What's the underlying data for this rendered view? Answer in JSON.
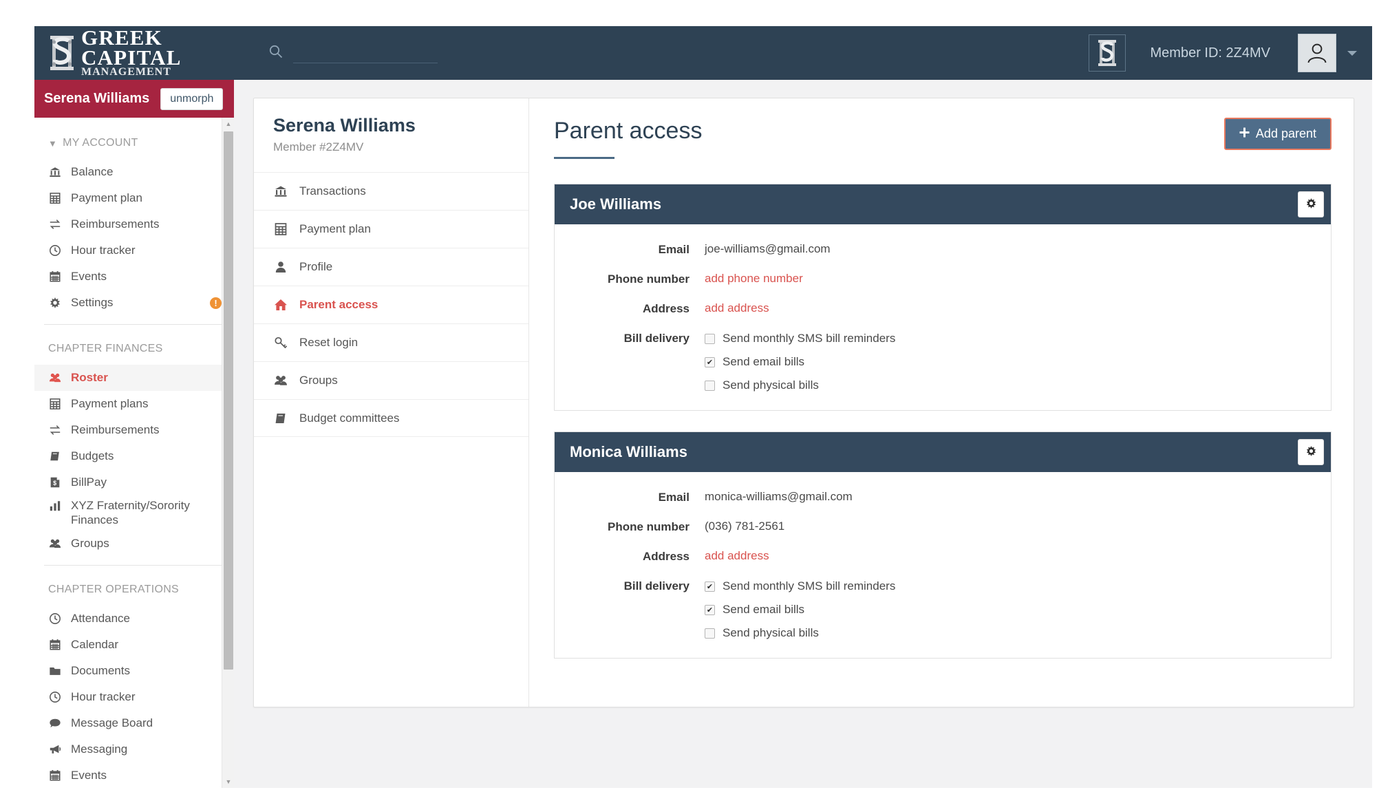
{
  "navbar": {
    "brand": {
      "line1": "GREEK",
      "line2": "CAPITAL",
      "line3": "MANAGEMENT",
      "logo_icon": "greek-column-s-logo"
    },
    "search": {
      "placeholder": "",
      "value": "",
      "icon": "search-icon"
    },
    "chapter_badge_icon": "chapter-crest-icon",
    "member_id": "Member ID: 2Z4MV",
    "avatar_icon": "user-avatar-icon",
    "caret_icon": "chevron-down-icon"
  },
  "morph": {
    "name": "Serena Williams",
    "unmorph_label": "unmorph"
  },
  "sidebar": {
    "groups": [
      {
        "title": "MY ACCOUNT",
        "collapsible": true,
        "items": [
          {
            "label": "Balance",
            "icon": "bank-icon",
            "active": false
          },
          {
            "label": "Payment plan",
            "icon": "calculator-icon",
            "active": false
          },
          {
            "label": "Reimbursements",
            "icon": "exchange-icon",
            "active": false
          },
          {
            "label": "Hour tracker",
            "icon": "clock-icon",
            "active": false
          },
          {
            "label": "Events",
            "icon": "calendar-icon",
            "active": false
          },
          {
            "label": "Settings",
            "icon": "gear-icon",
            "active": false,
            "badge": "!"
          }
        ]
      },
      {
        "title": "CHAPTER FINANCES",
        "collapsible": false,
        "items": [
          {
            "label": "Roster",
            "icon": "users-icon",
            "active": true
          },
          {
            "label": "Payment plans",
            "icon": "calculator-icon",
            "active": false
          },
          {
            "label": "Reimbursements",
            "icon": "exchange-icon",
            "active": false
          },
          {
            "label": "Budgets",
            "icon": "book-icon",
            "active": false
          },
          {
            "label": "BillPay",
            "icon": "invoice-dollar-icon",
            "active": false
          },
          {
            "label": "XYZ Fraternity/Sorority Finances",
            "icon": "bar-chart-icon",
            "active": false,
            "wrap": true
          },
          {
            "label": "Groups",
            "icon": "users-icon",
            "active": false
          }
        ]
      },
      {
        "title": "CHAPTER OPERATIONS",
        "collapsible": false,
        "items": [
          {
            "label": "Attendance",
            "icon": "clock-icon",
            "active": false
          },
          {
            "label": "Calendar",
            "icon": "calendar-icon",
            "active": false
          },
          {
            "label": "Documents",
            "icon": "folder-icon",
            "active": false
          },
          {
            "label": "Hour tracker",
            "icon": "clock-icon",
            "active": false
          },
          {
            "label": "Message Board",
            "icon": "comment-icon",
            "active": false
          },
          {
            "label": "Messaging",
            "icon": "bullhorn-icon",
            "active": false
          },
          {
            "label": "Events",
            "icon": "calendar-icon",
            "active": false
          }
        ]
      }
    ]
  },
  "member_nav": {
    "name": "Serena Williams",
    "subtitle": "Member #2Z4MV",
    "items": [
      {
        "label": "Transactions",
        "icon": "bank-icon",
        "active": false
      },
      {
        "label": "Payment plan",
        "icon": "calculator-icon",
        "active": false
      },
      {
        "label": "Profile",
        "icon": "user-icon",
        "active": false
      },
      {
        "label": "Parent access",
        "icon": "home-icon",
        "active": true
      },
      {
        "label": "Reset login",
        "icon": "key-icon",
        "active": false
      },
      {
        "label": "Groups",
        "icon": "users-icon",
        "active": false
      },
      {
        "label": "Budget committees",
        "icon": "book-icon",
        "active": false
      }
    ]
  },
  "main": {
    "title": "Parent access",
    "add_parent_label": "Add parent",
    "add_parent_icon": "plus-icon",
    "labels": {
      "email": "Email",
      "phone": "Phone number",
      "address": "Address",
      "bill_delivery": "Bill delivery"
    },
    "parents": [
      {
        "name": "Joe Williams",
        "gear_icon": "gear-icon",
        "email": "joe-williams@gmail.com",
        "phone": "add phone number",
        "phone_is_link": true,
        "address": "add address",
        "address_is_link": true,
        "bill_delivery": [
          {
            "label": "Send monthly SMS bill reminders",
            "checked": false
          },
          {
            "label": "Send email bills",
            "checked": true
          },
          {
            "label": "Send physical bills",
            "checked": false
          }
        ]
      },
      {
        "name": "Monica Williams",
        "gear_icon": "gear-icon",
        "email": "monica-williams@gmail.com",
        "phone": "(036) 781-2561",
        "phone_is_link": false,
        "address": "add address",
        "address_is_link": true,
        "bill_delivery": [
          {
            "label": "Send monthly SMS bill reminders",
            "checked": true
          },
          {
            "label": "Send email bills",
            "checked": true
          },
          {
            "label": "Send physical bills",
            "checked": false
          }
        ]
      }
    ]
  },
  "colors": {
    "navbar": "#2e4254",
    "morph_bar": "#a62440",
    "card_header": "#34495e",
    "accent_red": "#d9534f",
    "button_blue": "#4f6d8a",
    "focus_orange": "#e8775c",
    "warn_orange": "#ef9235"
  }
}
